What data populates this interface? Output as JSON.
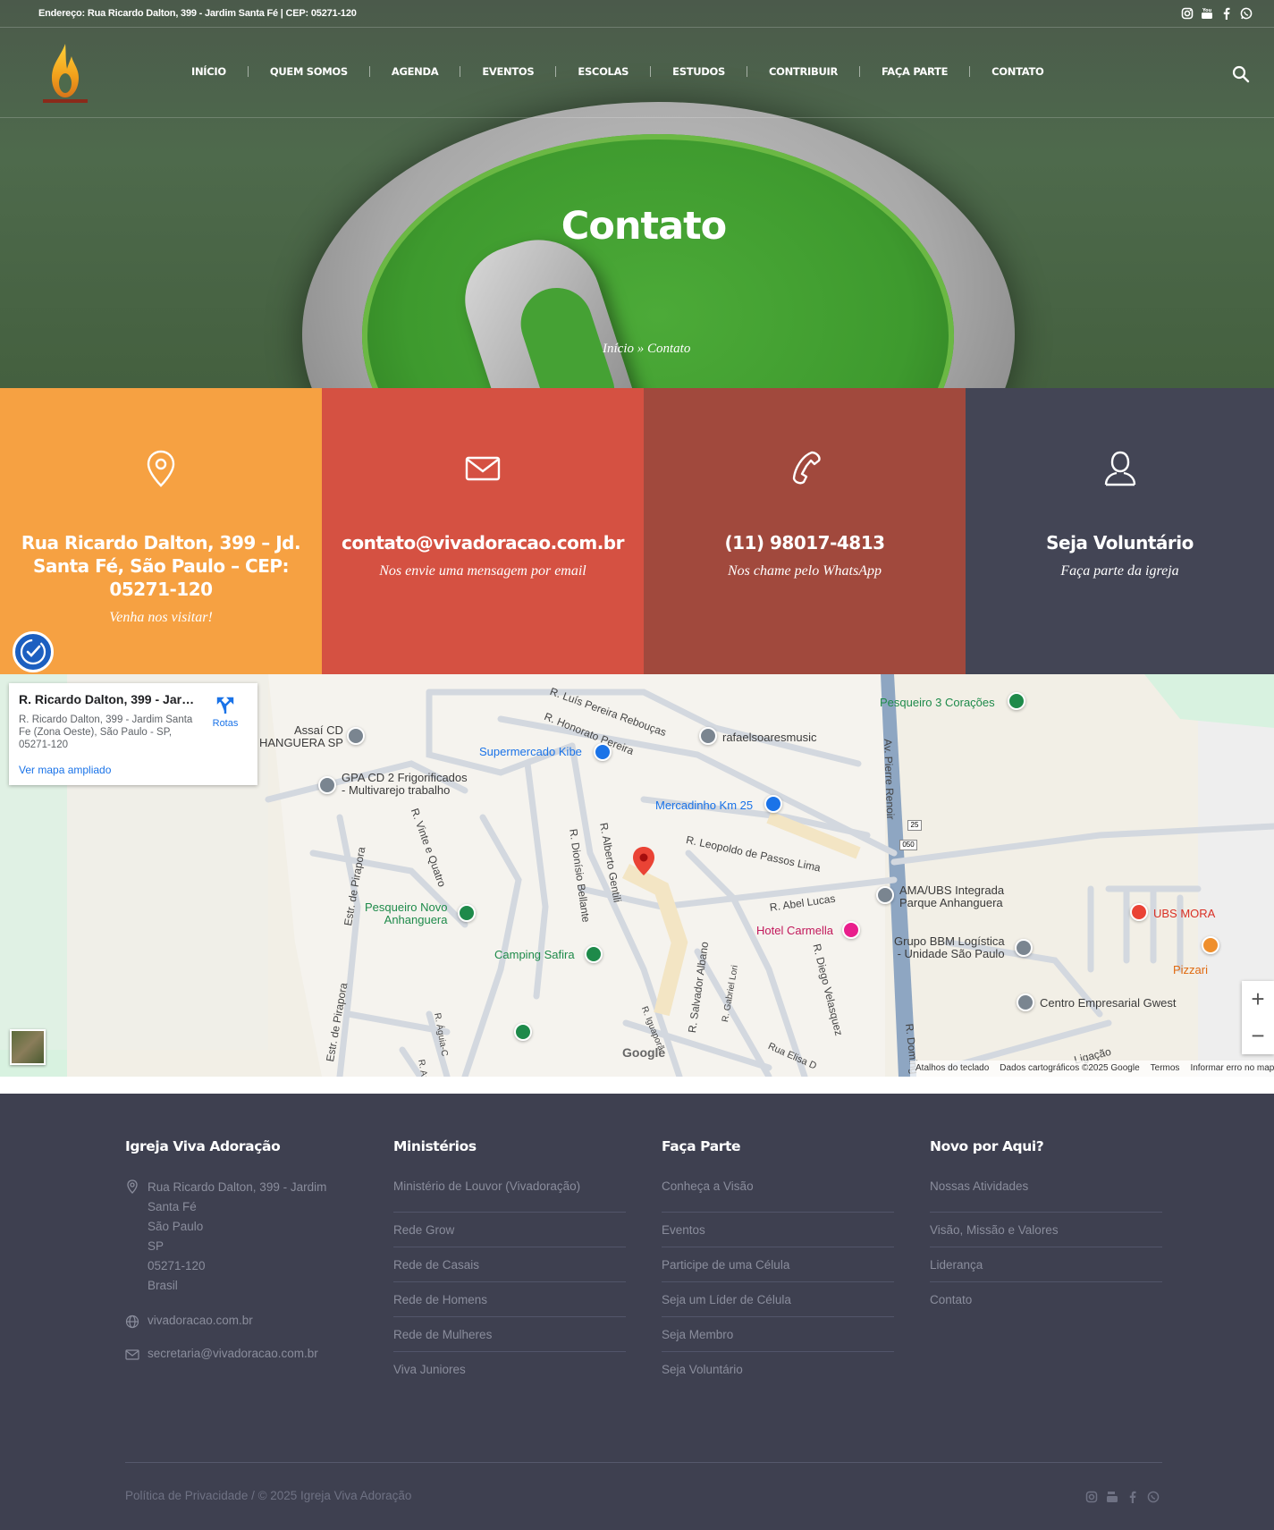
{
  "topbar": {
    "address": "Endereço: Rua Ricardo Dalton, 399 - Jardim Santa Fé | CEP: 05271-120",
    "social_icons": [
      "instagram-icon",
      "youtube-icon",
      "facebook-icon",
      "whatsapp-icon"
    ]
  },
  "nav": {
    "items": [
      "INÍCIO",
      "QUEM SOMOS",
      "AGENDA",
      "EVENTOS",
      "ESCOLAS",
      "ESTUDOS",
      "CONTRIBUIR",
      "FAÇA PARTE",
      "CONTATO"
    ]
  },
  "hero": {
    "title": "Contato",
    "breadcrumb": "Início » Contato"
  },
  "boxes": [
    {
      "icon": "map-pin-icon",
      "title": "Rua Ricardo Dalton, 399 – Jd. Santa Fé, São Paulo – CEP: 05271-120",
      "subtitle": "Venha nos visitar!",
      "color": "#f6a142"
    },
    {
      "icon": "envelope-icon",
      "title": "contato@vivadoracao.com.br",
      "subtitle": "Nos envie uma mensagem por email",
      "color": "#d55142"
    },
    {
      "icon": "phone-icon",
      "title": "(11) 98017-4813",
      "subtitle": "Nos chame pelo WhatsApp",
      "color": "#a1493d"
    },
    {
      "icon": "user-icon",
      "title": "Seja Voluntário",
      "subtitle": "Faça parte da igreja",
      "color": "#434555"
    }
  ],
  "map": {
    "card_title": "R. Ricardo Dalton, 399 - Jardi...",
    "card_address": "R. Ricardo Dalton, 399 - Jardim Santa Fe (Zona Oeste), São Paulo - SP, 05271-120",
    "card_link": "Ver mapa ampliado",
    "card_route": "Rotas",
    "places": {
      "pesqueiro3": "Pesqueiro 3 Corações",
      "assai": "Assaí CD\nHANGUERA SP",
      "rafael": "rafaelsoaresmusic",
      "kibe": "Supermercado Kibe",
      "gpa": "GPA CD 2 Frigorificados\n- Multivarejo trabalho",
      "mercadinho": "Mercadinho Km 25",
      "ama": "AMA/UBS Integrada\nParque Anhanguera",
      "pesqueiroNovo": "Pesqueiro Novo\nAnhanguera",
      "ubs": "UBS MORA",
      "hotel": "Hotel Carmella",
      "bbm": "Grupo BBM Logística\n- Unidade São Paulo",
      "camping": "Camping Safira",
      "pizzaria": "Pizzari",
      "gwest": "Centro Empresarial Gwest"
    },
    "streets": {
      "s1": "R. Luís Pereira Rebouças",
      "s2": "R. Honorato Pereira",
      "s3": "Av. Pierre Renoir",
      "s4": "R. Leopoldo de Passos Lima",
      "s5": "R. Dionísio Bellante",
      "s6": "R. Alberto Gentili",
      "s7": "R. Vinte e Quatro",
      "s8": "Estr. de Pirapora",
      "s9": "R. Abel Lucas",
      "s10": "R. Salvador Albano",
      "s11": "R. Gabriel Lori",
      "s12": "R. Diego Velasquez",
      "s13": "Estr. de Pirapora",
      "s14": "R. Iguaporã",
      "s15": "R. Águia-C",
      "s16": "R. Doming",
      "s17": "Rua Elisa D",
      "s18": "Ligação",
      "s19": "R. Az"
    },
    "shields": [
      "25",
      "050"
    ],
    "google": "Google",
    "attribution": [
      "Atalhos do teclado",
      "Dados cartográficos ©2025 Google",
      "Termos",
      "Informar erro no map"
    ]
  },
  "footer": {
    "col1": {
      "title": "Igreja Viva Adoração",
      "address_lines": [
        "Rua Ricardo Dalton, 399 - Jardim",
        "Santa Fé",
        "São Paulo",
        "SP",
        "05271-120",
        "Brasil"
      ],
      "website": "vivadoracao.com.br",
      "email": "secretaria@vivadoracao.com.br"
    },
    "col2": {
      "title": "Ministérios",
      "links": [
        "Ministério de Louvor (Vivadoração)",
        "Rede Grow",
        "Rede de Casais",
        "Rede de Homens",
        "Rede de Mulheres",
        "Viva Juniores"
      ]
    },
    "col3": {
      "title": "Faça Parte",
      "links": [
        "Conheça a Visão",
        "Eventos",
        "Participe de uma Célula",
        "Seja um Líder de Célula",
        "Seja Membro",
        "Seja Voluntário"
      ]
    },
    "col4": {
      "title": "Novo por Aqui?",
      "links": [
        "Nossas Atividades",
        "Visão, Missão e Valores",
        "Liderança",
        "Contato"
      ]
    },
    "copyright": "Política de Privacidade / © 2025 Igreja Viva Adoração",
    "social_icons": [
      "instagram-icon",
      "youtube-icon",
      "facebook-icon",
      "whatsapp-icon"
    ]
  }
}
